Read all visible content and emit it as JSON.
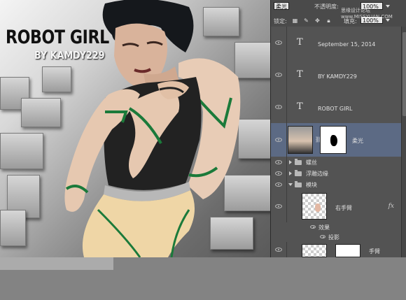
{
  "artwork": {
    "title": "ROBOT GIRL",
    "byline": "BY KAMDY229"
  },
  "panel": {
    "blend_mode": "柔光",
    "opacity_label": "不透明度:",
    "opacity_value": "100%",
    "lock_label": "锁定:",
    "fill_label": "填充:",
    "fill_value": "100%",
    "watermark": "思缘设计论坛 www.MISSYUAN.COM",
    "layers": [
      {
        "kind": "text",
        "name": "September 15, 2014"
      },
      {
        "kind": "text",
        "name": "BY KAMDY229"
      },
      {
        "kind": "text",
        "name": "ROBOT GIRL"
      },
      {
        "kind": "adjust",
        "name": "柔光"
      },
      {
        "kind": "group",
        "name": "螺丝"
      },
      {
        "kind": "group",
        "name": "浮雕边缘"
      },
      {
        "kind": "group",
        "name": "模块"
      },
      {
        "kind": "layer",
        "name": "右手臂",
        "fx": "fx"
      },
      {
        "kind": "effect",
        "name": "效果"
      },
      {
        "kind": "effect",
        "name": "投影"
      },
      {
        "kind": "layer",
        "name": "手臂"
      }
    ]
  },
  "colors": {
    "panel_bg": "#535353",
    "selected_row": "#5c6a84",
    "chrome_green": "#1b7a3a",
    "skin": "#e6c8b0"
  }
}
